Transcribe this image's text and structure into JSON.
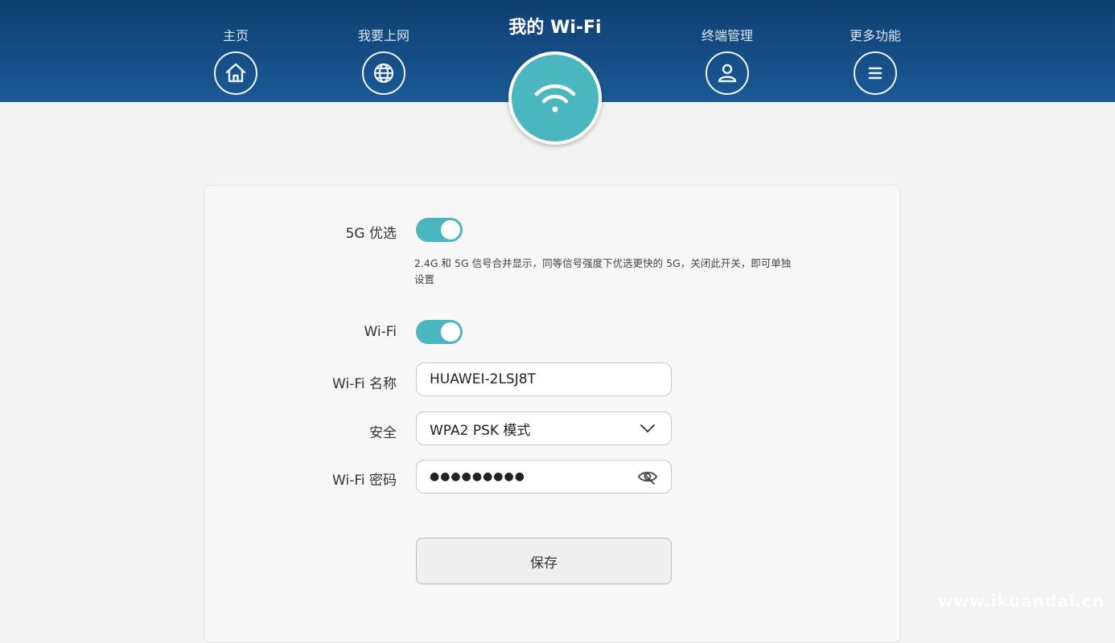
{
  "nav": {
    "home": {
      "label": "主页",
      "icon": "home-icon"
    },
    "internet": {
      "label": "我要上网",
      "icon": "globe-icon"
    },
    "wifi": {
      "label": "我的 Wi-Fi",
      "icon": "wifi-icon"
    },
    "devices": {
      "label": "终端管理",
      "icon": "user-icon"
    },
    "more": {
      "label": "更多功能",
      "icon": "menu-icon"
    }
  },
  "form": {
    "prefer5g": {
      "label": "5G 优选",
      "on": true,
      "hint": "2.4G 和 5G 信号合并显示，同等信号强度下优选更快的 5G，关闭此开关，即可单独设置"
    },
    "wifi_switch": {
      "label": "Wi-Fi",
      "on": true
    },
    "ssid": {
      "label": "Wi-Fi 名称",
      "value": "HUAWEI-2LSJ8T"
    },
    "security": {
      "label": "安全",
      "value": "WPA2 PSK 模式"
    },
    "password": {
      "label": "Wi-Fi 密码",
      "value": "●●●●●●●●●"
    },
    "save_label": "保存"
  },
  "watermark": "www.ikuandai.cn",
  "colors": {
    "header": "#1a5a96",
    "accent": "#4ab6bf",
    "background": "#f3f3f3"
  }
}
